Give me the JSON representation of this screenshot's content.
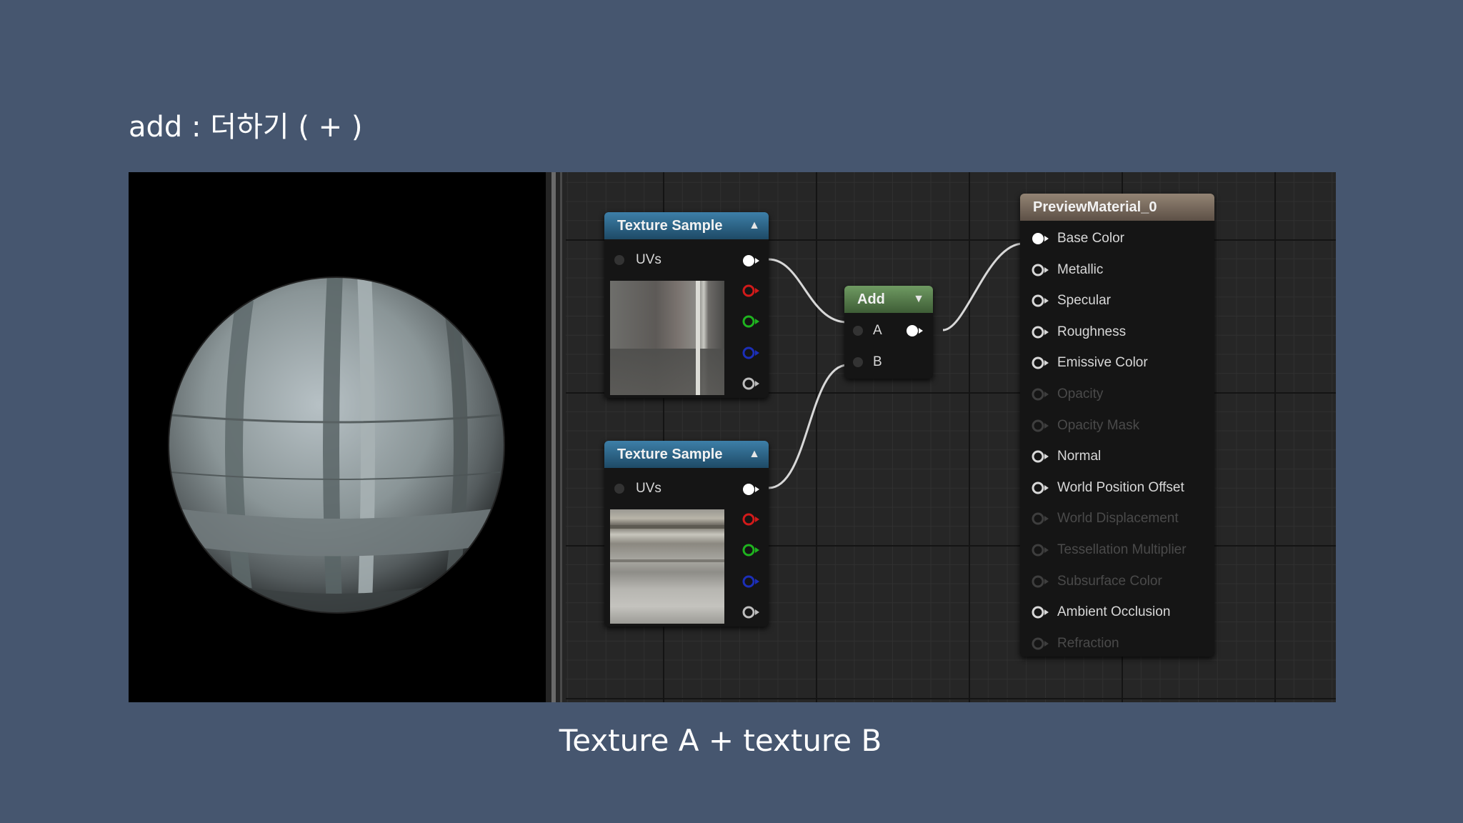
{
  "slide": {
    "title": "add : 더하기 ( + )",
    "caption": "Texture A + texture B"
  },
  "graph": {
    "texture_sample_1": {
      "title": "Texture Sample",
      "uv_label": "UVs"
    },
    "texture_sample_2": {
      "title": "Texture Sample",
      "uv_label": "UVs"
    },
    "add_node": {
      "title": "Add",
      "input_a": "A",
      "input_b": "B"
    },
    "material_node": {
      "title": "PreviewMaterial_0",
      "pins": [
        {
          "label": "Base Color",
          "enabled": true
        },
        {
          "label": "Metallic",
          "enabled": true
        },
        {
          "label": "Specular",
          "enabled": true
        },
        {
          "label": "Roughness",
          "enabled": true
        },
        {
          "label": "Emissive Color",
          "enabled": true
        },
        {
          "label": "Opacity",
          "enabled": false
        },
        {
          "label": "Opacity Mask",
          "enabled": false
        },
        {
          "label": "Normal",
          "enabled": true
        },
        {
          "label": "World Position Offset",
          "enabled": true
        },
        {
          "label": "World Displacement",
          "enabled": false
        },
        {
          "label": "Tessellation Multiplier",
          "enabled": false
        },
        {
          "label": "Subsurface Color",
          "enabled": false
        },
        {
          "label": "Ambient Occlusion",
          "enabled": true
        },
        {
          "label": "Refraction",
          "enabled": false
        }
      ]
    }
  },
  "colors": {
    "background": "#46566f",
    "texture_header": "#2d6b93",
    "add_header": "#5b844f",
    "material_header": "#7d6f61",
    "pin_red": "#d11a1a",
    "pin_green": "#1fb31f",
    "pin_blue": "#1c2fb8"
  }
}
